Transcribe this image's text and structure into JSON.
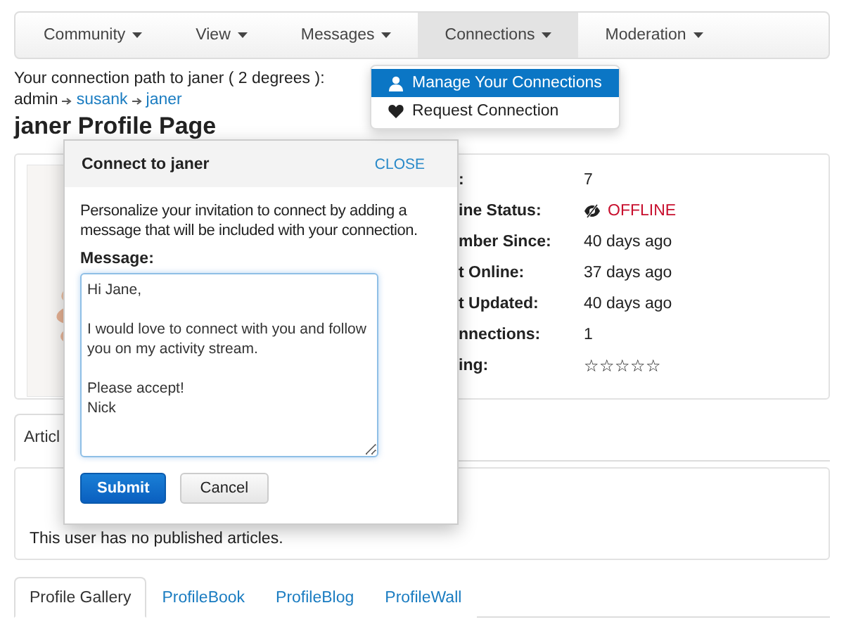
{
  "navbar": {
    "items": [
      {
        "label": "Community",
        "selected": false
      },
      {
        "label": "View",
        "selected": false
      },
      {
        "label": "Messages",
        "selected": false
      },
      {
        "label": "Connections",
        "selected": true
      },
      {
        "label": "Moderation",
        "selected": false
      }
    ]
  },
  "dropdown": {
    "items": [
      {
        "label": "Manage Your Connections",
        "kind": "user",
        "selected": true
      },
      {
        "label": "Request Connection",
        "kind": "heart",
        "selected": false
      }
    ]
  },
  "connection_path": {
    "intro": "Your connection path to janer ( 2 degrees ):",
    "nodes": [
      {
        "name": "admin",
        "link": false
      },
      {
        "name": "susank",
        "link": true
      },
      {
        "name": "janer",
        "link": true
      }
    ]
  },
  "heading": "janer Profile Page",
  "profile": {
    "stats": [
      {
        "label": ":",
        "value": "7",
        "kind": "text"
      },
      {
        "label": "ine Status:",
        "value": "OFFLINE",
        "kind": "status"
      },
      {
        "label": "mber Since:",
        "value": "40 days ago",
        "kind": "text"
      },
      {
        "label": "t Online:",
        "value": "37 days ago",
        "kind": "text"
      },
      {
        "label": "t Updated:",
        "value": "40 days ago",
        "kind": "text"
      },
      {
        "label": "nnections:",
        "value": "1",
        "kind": "text"
      },
      {
        "label": "ing:",
        "kind": "rating",
        "stars": 0
      }
    ]
  },
  "articles_tab": {
    "label": "Articl",
    "selected": true
  },
  "articles": {
    "empty_text": "This user has no published articles."
  },
  "profile_tabs": [
    {
      "label": "Profile Gallery",
      "selected": true
    },
    {
      "label": "ProfileBook",
      "selected": false
    },
    {
      "label": "ProfileBlog",
      "selected": false
    },
    {
      "label": "ProfileWall",
      "selected": false
    }
  ],
  "modal": {
    "title": "Connect to janer",
    "close": "CLOSE",
    "intro": "Personalize your invitation to connect by adding a message that will be included with your connection.",
    "message_label": "Message:",
    "message": "Hi Jane,\n\nI would love to connect with you and follow you on my activity stream.\n\nPlease accept!\nNick",
    "buttons": [
      {
        "label": "Submit",
        "kind": "primary"
      },
      {
        "label": "Cancel",
        "kind": "default"
      }
    ]
  }
}
